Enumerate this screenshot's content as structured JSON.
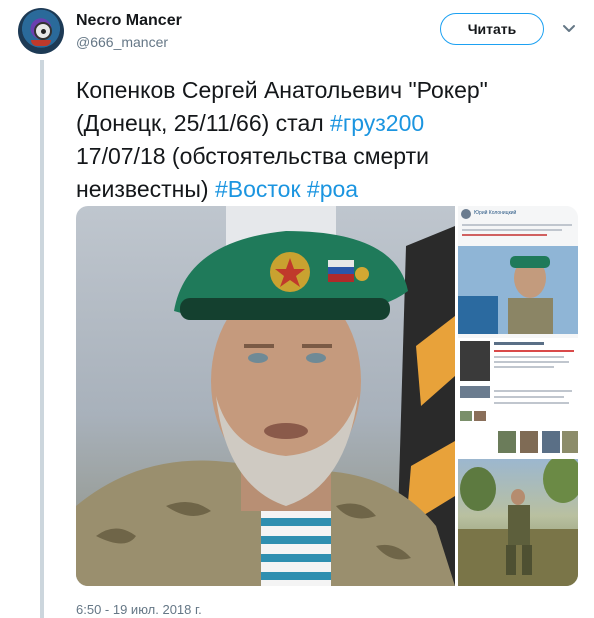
{
  "tweet": {
    "author": {
      "display_name": "Necro Mancer",
      "handle": "@666_mancer",
      "avatar_icon": "cartoon-monster-avatar"
    },
    "follow_label": "Читать",
    "menu_icon": "chevron-down-icon",
    "text": {
      "line1": "Копенков Сергей Анатольевич \"Рокер\"",
      "line2_prefix": "(Донецк, 25/11/66) стал ",
      "hashtag_cargo": "#груз200",
      "line3": "17/07/18 (обстоятельства смерти",
      "line4_prefix": "неизвестны) ",
      "hashtag_east": "#Восток",
      "hashtag_roa": "#роа"
    },
    "media": {
      "main_photo": "portrait-man-green-beret",
      "side_top_caption": "Юрий Колоницкий",
      "side_bottom_photo": "soldier-field"
    },
    "timestamp": "6:50 - 19 июл. 2018 г."
  },
  "colors": {
    "accent": "#1da1f2",
    "hashtag": "#1b95e0",
    "text": "#14171a",
    "muted": "#657786",
    "thread_line": "#ccd6dd"
  }
}
